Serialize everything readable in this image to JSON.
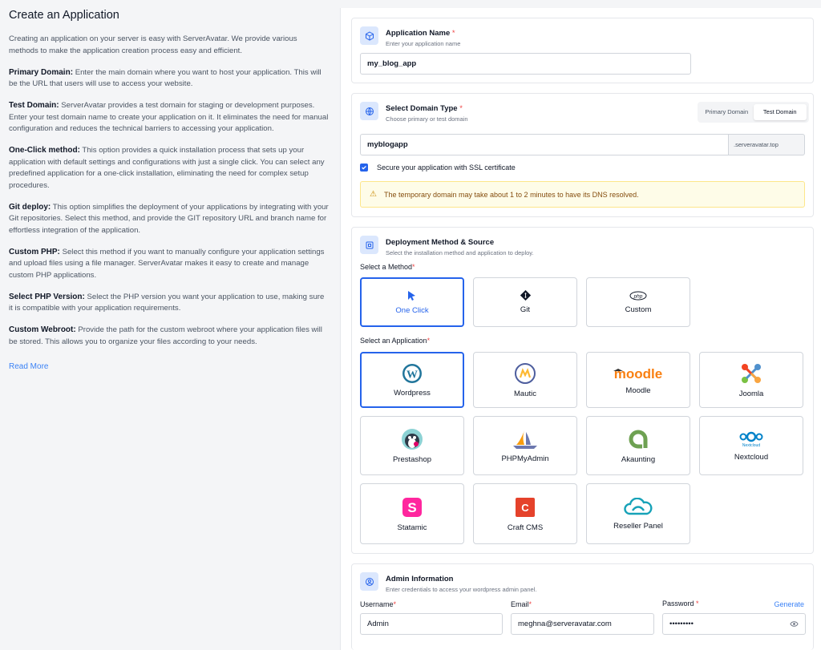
{
  "left": {
    "title": "Create an Application",
    "intro": "Creating an application on your server is easy with ServerAvatar. We provide various methods to make the application creation process easy and efficient.",
    "sections": [
      {
        "term": "Primary Domain:",
        "text": " Enter the main domain where you want to host your application. This will be the URL that users will use to access your website."
      },
      {
        "term": "Test Domain:",
        "text": " ServerAvatar provides a test domain for staging or development purposes. Enter your test domain name to create your application on it. It eliminates the need for manual configuration and reduces the technical barriers to accessing your application."
      },
      {
        "term": "One-Click method:",
        "text": " This option provides a quick installation process that sets up your application with default settings and configurations with just a single click. You can select any predefined application for a one-click installation, eliminating the need for complex setup procedures."
      },
      {
        "term": "Git deploy:",
        "text": " This option simplifies the deployment of your applications by integrating with your Git repositories. Select this method, and provide the GIT repository URL and branch name for effortless integration of the application."
      },
      {
        "term": "Custom PHP:",
        "text": " Select this method if you want to manually configure your application settings and upload files using a file manager. ServerAvatar makes it easy to create and manage custom PHP applications."
      },
      {
        "term": "Select PHP Version:",
        "text": " Select the PHP version you want your application to use, making sure it is compatible with your application requirements."
      },
      {
        "term": "Custom Webroot:",
        "text": " Provide the path for the custom webroot where your application files will be stored. This allows you to organize your files according to your needs."
      }
    ],
    "read_more": "Read More"
  },
  "app_name": {
    "title": "Application Name",
    "required": "*",
    "subtitle": "Enter your application name",
    "value": "my_blog_app",
    "icon": "cube-icon"
  },
  "domain": {
    "title": "Select Domain Type",
    "required": "*",
    "subtitle": "Choose primary or test domain",
    "tabs": [
      "Primary Domain",
      "Test Domain"
    ],
    "active_tab": "Test Domain",
    "value": "myblogapp",
    "suffix": ".serveravatar.top",
    "ssl_label": "Secure your application with SSL certificate",
    "ssl_checked": true,
    "alert": "The temporary domain may take about 1 to 2 minutes to have its DNS resolved.",
    "icon": "globe-icon"
  },
  "deploy": {
    "title": "Deployment Method & Source",
    "subtitle": "Select the installation method and application to deploy.",
    "method_label": "Select a Method",
    "app_label": "Select an Application",
    "required": "*",
    "methods": [
      {
        "label": "One Click",
        "icon": "cursor-icon",
        "selected": true
      },
      {
        "label": "Git",
        "icon": "git-icon",
        "selected": false
      },
      {
        "label": "Custom",
        "icon": "php-icon",
        "selected": false
      }
    ],
    "apps": [
      {
        "label": "Wordpress",
        "icon": "wordpress-icon",
        "selected": true
      },
      {
        "label": "Mautic",
        "icon": "mautic-icon",
        "selected": false
      },
      {
        "label": "Moodle",
        "icon": "moodle-icon",
        "selected": false,
        "logo_text": "moodle"
      },
      {
        "label": "Joomla",
        "icon": "joomla-icon",
        "selected": false
      },
      {
        "label": "Prestashop",
        "icon": "prestashop-icon",
        "selected": false
      },
      {
        "label": "PHPMyAdmin",
        "icon": "phpmyadmin-icon",
        "selected": false
      },
      {
        "label": "Akaunting",
        "icon": "akaunting-icon",
        "selected": false
      },
      {
        "label": "Nextcloud",
        "icon": "nextcloud-icon",
        "selected": false,
        "logo_text": "Nextcloud"
      },
      {
        "label": "Statamic",
        "icon": "statamic-icon",
        "selected": false
      },
      {
        "label": "Craft CMS",
        "icon": "craftcms-icon",
        "selected": false
      },
      {
        "label": "Reseller Panel",
        "icon": "reseller-cloud-icon",
        "selected": false
      }
    ],
    "icon": "deploy-icon"
  },
  "admin": {
    "title": "Admin Information",
    "subtitle": "Enter credentials to access your wordpress admin panel.",
    "username_label": "Username",
    "email_label": "Email",
    "password_label": "Password",
    "required": "*",
    "generate": "Generate",
    "username": "Admin",
    "email": "meghna@serveravatar.com",
    "password": "•••••••••",
    "icon": "user-circle-icon"
  },
  "colors": {
    "accent": "#2563eb",
    "required": "#ef4444",
    "alert_bg": "#fefce8",
    "alert_text": "#854d0e"
  }
}
